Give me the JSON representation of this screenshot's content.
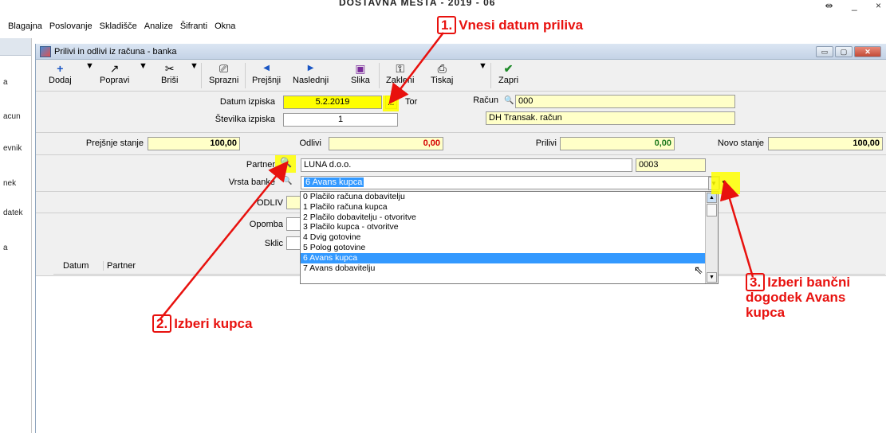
{
  "app": {
    "title": "DOSTAVNA MESTA - 2019 - 06",
    "window_controls": [
      "⇹",
      "_",
      "×"
    ]
  },
  "menu": [
    "Blagajna",
    "Poslovanje",
    "Skladišče",
    "Analize",
    "Šifranti",
    "Okna"
  ],
  "left_panel": {
    "items": [
      "a",
      "acun",
      "evnik",
      "nek",
      "datek",
      "a"
    ]
  },
  "child_window": {
    "title": "Prilivi in odlivi iz računa - banka",
    "controls": [
      "▭",
      "▢",
      "✕"
    ]
  },
  "toolbar": {
    "buttons": [
      {
        "label": "Dodaj",
        "icon": "+"
      },
      {
        "label": "Popravi",
        "icon": "↗"
      },
      {
        "label": "Briši",
        "icon": "✂"
      },
      {
        "label": "Sprazni",
        "icon": "⎚"
      },
      {
        "label": "Prejšnji",
        "icon": "◀"
      },
      {
        "label": "Naslednji",
        "icon": "▶"
      },
      {
        "label": "Slika",
        "icon": "▣"
      },
      {
        "label": "Zakleni",
        "icon": "⚿"
      },
      {
        "label": "Tiskaj",
        "icon": "⎙"
      },
      {
        "label": "Zapri",
        "icon": "✔"
      }
    ],
    "dropdown_arrow": "▼"
  },
  "form": {
    "datum_izpiska_label": "Datum izpiska",
    "datum_izpiska_value": "5.2.2019",
    "date_picker_label": "...",
    "day_label": "Tor",
    "racun_label": "Račun",
    "racun_value": "000",
    "racun_name": "DH Transak. račun",
    "stevilka_izpiska_label": "Številka izpiska",
    "stevilka_izpiska_value": "1",
    "prejsnje_stanje_label": "Prejšnje stanje",
    "prejsnje_stanje_value": "100,00",
    "odlivi_label": "Odlivi",
    "odlivi_value": "0,00",
    "prilivi_label": "Prilivi",
    "prilivi_value": "0,00",
    "novo_stanje_label": "Novo stanje",
    "novo_stanje_value": "100,00",
    "partner_label": "Partner",
    "partner_value": "LUNA d.o.o.",
    "partner_code": "0003",
    "vrsta_banke_label": "Vrsta banke",
    "vrsta_banke_value": "6 Avans kupca",
    "odliv_label": "ODLIV",
    "opomba_label": "Opomba",
    "sklic_label": "Sklic"
  },
  "dropdown_options": [
    "0 Plačilo računa dobavitelju",
    "1 Plačilo računa kupca",
    "2 Plačilo dobavitelju - otvoritve",
    "3 Plačilo kupca - otvoritve",
    "4 Dvig gotovine",
    "5 Polog gotovine",
    "6 Avans kupca",
    "7 Avans dobavitelju"
  ],
  "dropdown_selected_index": 6,
  "grid": {
    "columns": [
      "Datum",
      "Partner"
    ]
  },
  "annotations": [
    {
      "num": "1.",
      "text": "Vnesi datum priliva"
    },
    {
      "num": "2.",
      "text": "Izberi kupca"
    },
    {
      "num": "3.",
      "text": "Izberi bančni dogodek Avans kupca"
    }
  ],
  "colors": {
    "annotation": "#e8110e",
    "highlight": "#ffff00",
    "selection": "#3399ff",
    "field_yellow": "#ffffc8"
  }
}
